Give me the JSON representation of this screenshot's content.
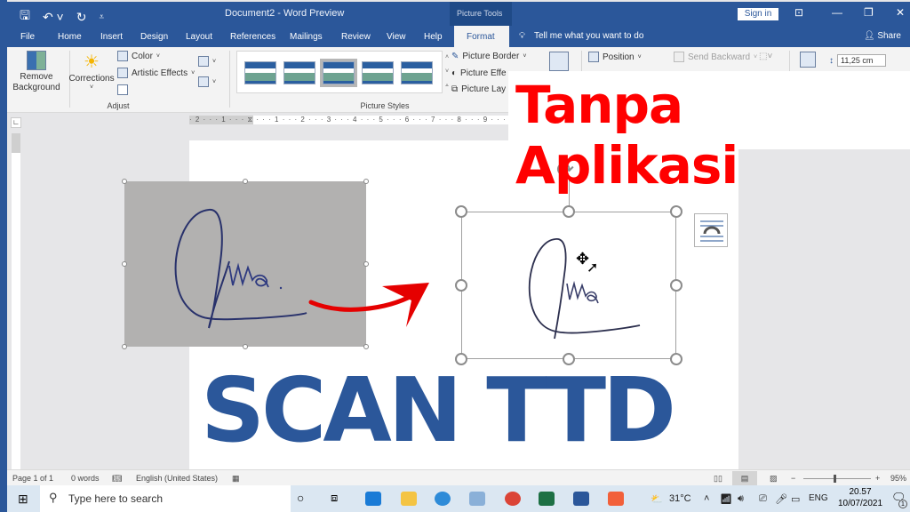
{
  "window": {
    "title": "Document2  -  Word Preview",
    "context_tab_group": "Picture Tools",
    "sign_in": "Sign in"
  },
  "tabs": [
    "File",
    "Home",
    "Insert",
    "Design",
    "Layout",
    "References",
    "Mailings",
    "Review",
    "View",
    "Help",
    "Format"
  ],
  "active_tab": "Format",
  "tell_me": "Tell me what you want to do",
  "share": "Share",
  "ribbon": {
    "adjust": {
      "remove_background": "Remove Background",
      "corrections": "Corrections",
      "color": "Color",
      "artistic_effects": "Artistic Effects",
      "label": "Adjust"
    },
    "picture_styles": {
      "picture_border": "Picture Border",
      "picture_effects": "Picture Effe",
      "picture_layout": "Picture Lay",
      "label": "Picture Styles"
    },
    "arrange": {
      "position": "Position",
      "send_backward": "Send Backward"
    },
    "size": {
      "height_value": "11,25 cm"
    }
  },
  "ruler": {
    "horizontal": "· 2 · · · 1 · · · ⧖ · · · 1 · · · 2 · · · 3 · · · 4 · · · 5 · · · 6 · · · 7 · · · 8 · · · 9 · · · 1"
  },
  "overlay": {
    "banner_text": "Tanpa Aplikasi",
    "headline": "SCAN TTD",
    "banner_color": "#ff0000",
    "headline_color": "#2b579a"
  },
  "statusbar": {
    "page": "Page 1 of 1",
    "words": "0 words",
    "language": "English (United States)",
    "zoom": "95%",
    "zoom_percent": 95
  },
  "taskbar": {
    "search_placeholder": "Type here to search",
    "weather": "31°C",
    "input_lang": "ENG",
    "time": "20.57",
    "date": "10/07/2021",
    "notification_count": "1"
  },
  "colors": {
    "word_blue": "#2b579a",
    "ribbon_bg": "#f3f3f3"
  }
}
